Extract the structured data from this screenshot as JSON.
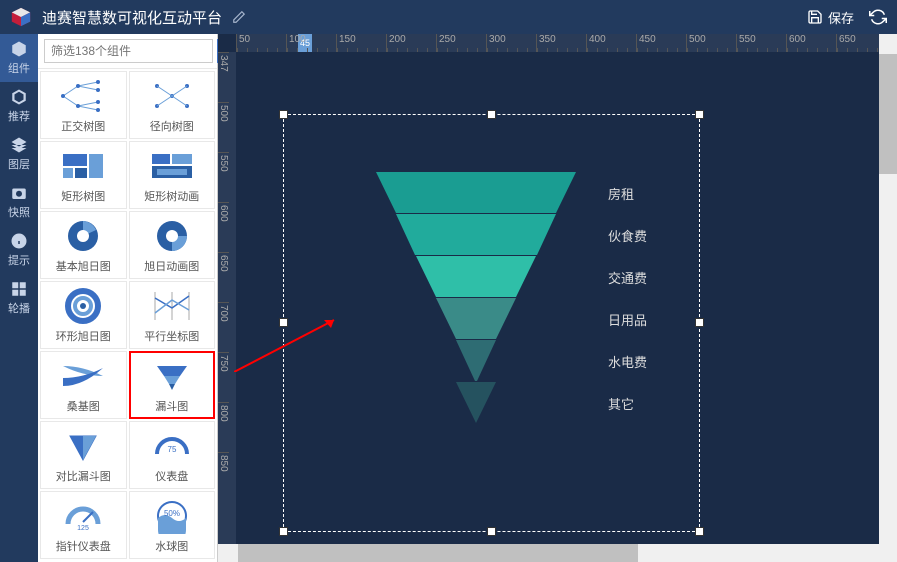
{
  "header": {
    "title": "迪赛智慧数可视化互动平台",
    "save_label": "保存"
  },
  "nav": {
    "items": [
      {
        "label": "组件"
      },
      {
        "label": "推荐"
      },
      {
        "label": "图层"
      },
      {
        "label": "快照"
      },
      {
        "label": "提示"
      },
      {
        "label": "轮播"
      }
    ]
  },
  "search": {
    "placeholder": "筛选138个组件"
  },
  "components": [
    {
      "label": "正交树图"
    },
    {
      "label": "径向树图"
    },
    {
      "label": "矩形树图"
    },
    {
      "label": "矩形树动画"
    },
    {
      "label": "基本旭日图"
    },
    {
      "label": "旭日动画图"
    },
    {
      "label": "环形旭日图"
    },
    {
      "label": "平行坐标图"
    },
    {
      "label": "桑基图"
    },
    {
      "label": "漏斗图"
    },
    {
      "label": "对比漏斗图"
    },
    {
      "label": "仪表盘"
    },
    {
      "label": "指针仪表盘"
    },
    {
      "label": "水球图"
    }
  ],
  "ruler": {
    "highlight": "45",
    "h_ticks": [
      "50",
      "100",
      "150",
      "200",
      "250",
      "300",
      "350",
      "400",
      "450",
      "500",
      "550",
      "600",
      "650"
    ],
    "v_ticks": [
      "347",
      "500",
      "550",
      "600",
      "650",
      "700",
      "750",
      "800",
      "850"
    ]
  },
  "chart_data": {
    "type": "funnel",
    "title": "",
    "series": [
      {
        "name": "房租",
        "value": 100,
        "color": "#1a9d92"
      },
      {
        "name": "伙食费",
        "value": 83,
        "color": "#21ab9c"
      },
      {
        "name": "交通费",
        "value": 67,
        "color": "#2fbfa8"
      },
      {
        "name": "日用品",
        "value": 50,
        "color": "#3a8b88"
      },
      {
        "name": "水电费",
        "value": 33,
        "color": "#2e6c73"
      },
      {
        "name": "其它",
        "value": 17,
        "color": "#25525f"
      }
    ]
  }
}
